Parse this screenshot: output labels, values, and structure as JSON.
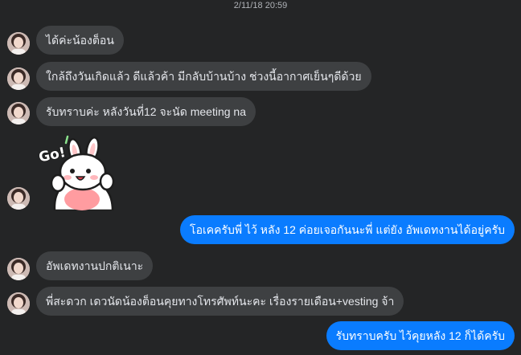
{
  "chat": {
    "timestamp": "2/11/18 20:59",
    "messages": [
      {
        "from": "contact",
        "text": "ได้ค่ะน้องต็อน"
      },
      {
        "from": "contact",
        "text": "ใกล้ถึงวันเกิดแล้ว ดีแล้วค้า มีกลับบ้านบ้าง ช่วงนี้อากาศเย็นๆดีด้วย"
      },
      {
        "from": "contact",
        "text": "รับทราบค่ะ หลังวันที่12 จะนัด meeting na"
      },
      {
        "from": "contact",
        "type": "sticker",
        "sticker_text": "Go!",
        "sticker_name": "bunny-go-sticker"
      },
      {
        "from": "me",
        "text": "โอเคครับพี่ ไว้ หลัง 12 ค่อยเจอกันนะพี่ แต่ยัง อัพเดทงานได้อยู่ครับ"
      },
      {
        "from": "contact",
        "text": "อัพเดทงานปกติเนาะ"
      },
      {
        "from": "contact",
        "text": "พี่สะดวก เดวนัดน้องต็อนคุยทางโทรศัพท์นะคะ เรื่องรายเดือน+vesting จ้า"
      },
      {
        "from": "me",
        "text": "รับทราบครับ ไว้คุยหลัง 12 ก็ได้ครับ"
      }
    ]
  },
  "colors": {
    "background": "#242526",
    "incoming_bubble": "#3e4042",
    "outgoing_bubble": "#0a7cff",
    "text_light": "#e4e6eb",
    "timestamp": "#b0b3b8"
  }
}
